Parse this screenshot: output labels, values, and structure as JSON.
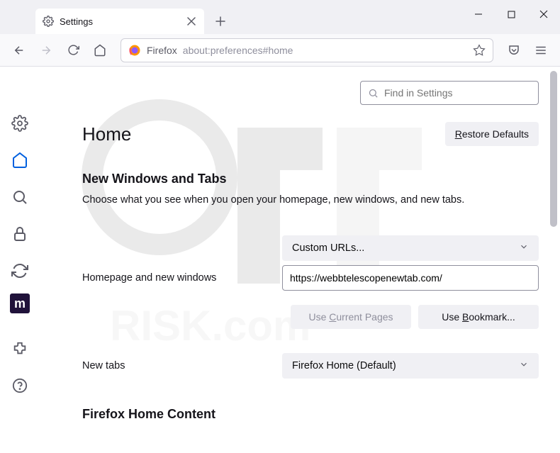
{
  "tab": {
    "title": "Settings"
  },
  "toolbar": {
    "identity": "Firefox",
    "url": "about:preferences#home"
  },
  "find": {
    "placeholder": "Find in Settings"
  },
  "page": {
    "title": "Home",
    "restore_label": "Restore Defaults",
    "section1_title": "New Windows and Tabs",
    "section1_desc": "Choose what you see when you open your homepage, new windows, and new tabs.",
    "homepage_label": "Homepage and new windows",
    "homepage_select": "Custom URLs...",
    "homepage_url": "https://webbtelescopenewtab.com/",
    "use_current": "Use Current Pages",
    "use_bookmark": "Use Bookmark...",
    "newtabs_label": "New tabs",
    "newtabs_select": "Firefox Home (Default)",
    "section2_title": "Firefox Home Content"
  },
  "sidebar": {
    "mozilla": "m"
  }
}
